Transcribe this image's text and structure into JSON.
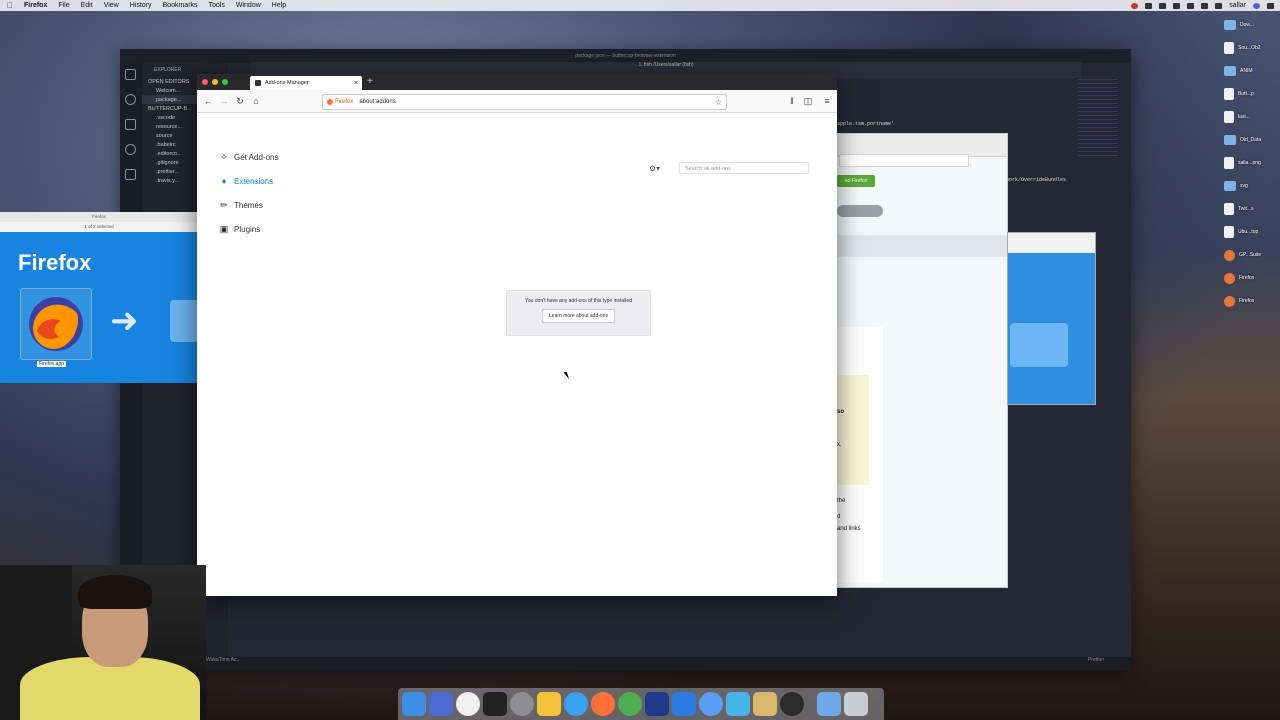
{
  "menubar": {
    "app": "Firefox",
    "items": [
      "File",
      "Edit",
      "View",
      "History",
      "Bookmarks",
      "Tools",
      "Window",
      "Help"
    ],
    "user": "sallar"
  },
  "desktop_icons": [
    "Dow...",
    "Sou...Ob2",
    "ANIM",
    "Butt...p",
    "last...",
    "Old_Data",
    "salla...png",
    "svg",
    "Twit...s",
    "Ubu...top",
    "GP...Suite",
    "Firefox",
    "Firefox"
  ],
  "vscode": {
    "title": "package.json — buttercup-browser-extension",
    "explorer_label": "EXPLORER",
    "open_editors_label": "OPEN EDITORS",
    "project_label": "BUTTERCUP-B...",
    "open_files": [
      "Welcom...",
      "package..."
    ],
    "tree": [
      ".vscode",
      "resource...",
      "source",
      ".babelrc",
      ".editorco...",
      ".gitignore",
      ".prettier...",
      ".travis.y..."
    ],
    "terminal_title": "1. fish  /Users/sallar (fish)",
    "code_line1": "apple.tsm.portname'",
    "code_line2": "work/OverrideBundles",
    "status_left": "WakaTime Ac...",
    "status_right": "Prettier"
  },
  "dmg": {
    "title": "Firefox",
    "subtitle": "1 of 2 selected",
    "brand": "Firefox",
    "app_label": "Firefox.app"
  },
  "chrome_back": {
    "button": "ad Firefox",
    "text1": "so",
    "text2": "x,",
    "text3": "the",
    "text4": "d",
    "text5": "and links"
  },
  "firefox": {
    "tab_title": "Add-ons Manager",
    "url_badge": "Firefox",
    "url": "about:addons",
    "search_placeholder": "Search all add-ons",
    "categories": [
      {
        "label": "Get Add-ons",
        "icon": "puzzle-sparkle"
      },
      {
        "label": "Extensions",
        "icon": "puzzle",
        "active": true
      },
      {
        "label": "Themes",
        "icon": "brush"
      },
      {
        "label": "Plugins",
        "icon": "briefcase"
      }
    ],
    "empty_message": "You don't have any add-ons of this type installed",
    "learn_more": "Learn more about add-ons"
  },
  "colors": {
    "accent": "#0a84ff",
    "firefox_orange": "#ff7139",
    "tab_strip": "#2a2a2e"
  }
}
